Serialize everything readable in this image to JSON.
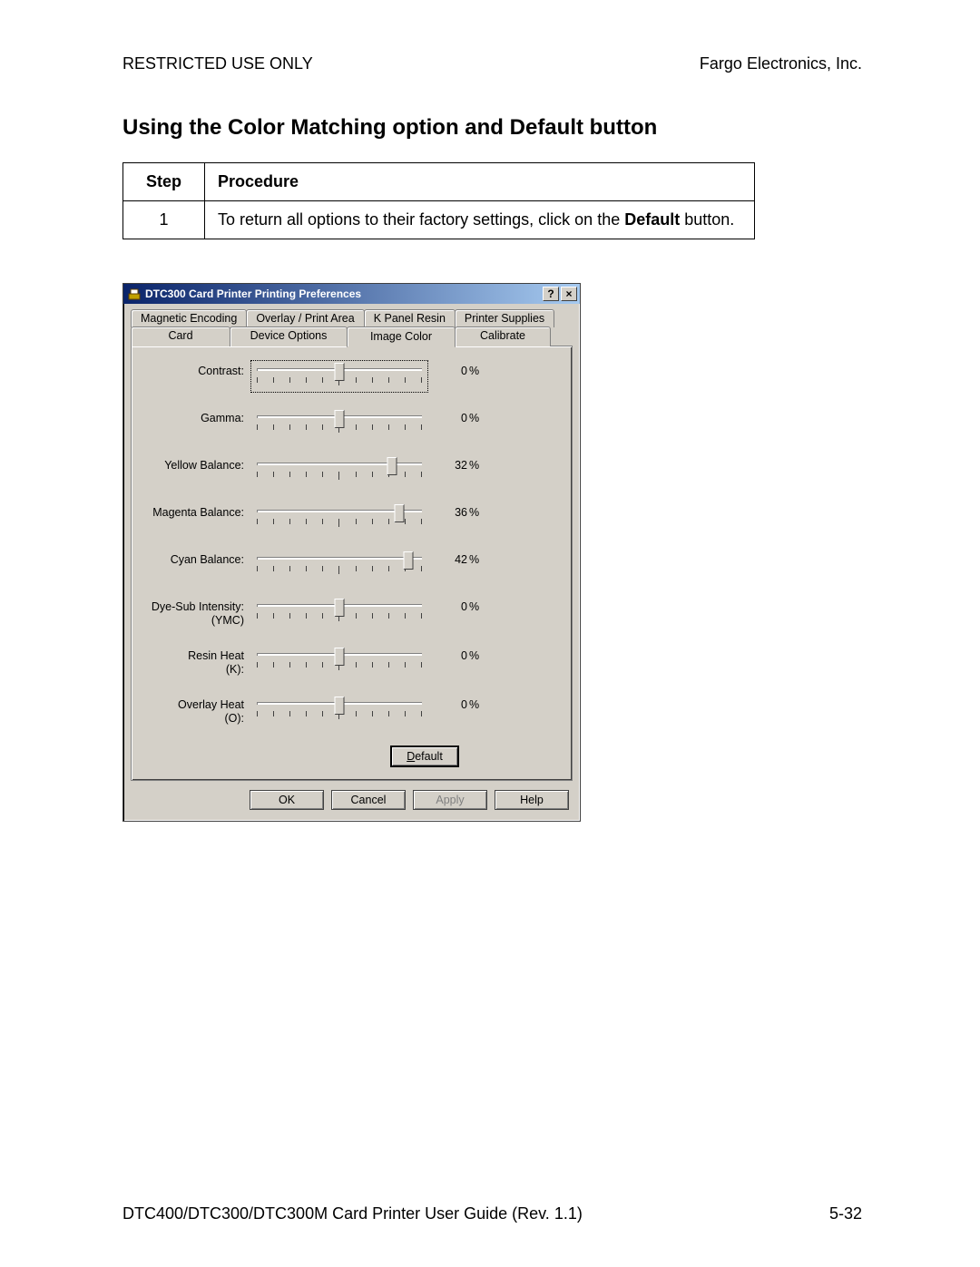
{
  "header": {
    "left": "RESTRICTED USE ONLY",
    "right": "Fargo Electronics, Inc."
  },
  "title": "Using the Color Matching option and Default button",
  "table": {
    "head_step": "Step",
    "head_proc": "Procedure",
    "rows": [
      {
        "step": "1",
        "proc_prefix": "To return all options to their factory settings, click on the ",
        "proc_bold": "Default",
        "proc_suffix": " button."
      }
    ]
  },
  "dialog": {
    "title": "DTC300 Card Printer Printing Preferences",
    "tabs_row1": [
      "Magnetic Encoding",
      "Overlay / Print Area",
      "K Panel Resin",
      "Printer Supplies"
    ],
    "tabs_row2": [
      "Card",
      "Device Options",
      "Image Color",
      "Calibrate"
    ],
    "active_tab": "Image Color",
    "sliders": [
      {
        "label": "Contrast:",
        "value": "0",
        "pos": 50,
        "focused": true
      },
      {
        "label": "Gamma:",
        "value": "0",
        "pos": 50
      },
      {
        "label": "Yellow Balance:",
        "value": "32",
        "pos": 82
      },
      {
        "label": "Magenta Balance:",
        "value": "36",
        "pos": 86
      },
      {
        "label": "Cyan Balance:",
        "value": "42",
        "pos": 92
      },
      {
        "label": "Dye-Sub Intensity: (YMC)",
        "value": "0",
        "pos": 50
      },
      {
        "label": "Resin Heat  (K):",
        "value": "0",
        "pos": 50
      },
      {
        "label": "Overlay Heat  (O):",
        "value": "0",
        "pos": 50
      }
    ],
    "default_btn": "Default",
    "buttons": {
      "ok": "OK",
      "cancel": "Cancel",
      "apply": "Apply",
      "help": "Help"
    }
  },
  "footer": {
    "left": "DTC400/DTC300/DTC300M Card Printer User Guide (Rev. 1.1)",
    "right": "5-32"
  },
  "pct_symbol": "%"
}
